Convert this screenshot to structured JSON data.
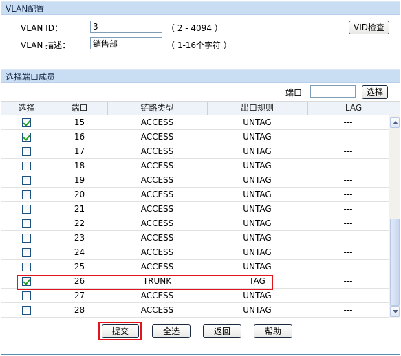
{
  "vlan_config": {
    "section_title": "VLAN配置",
    "vlan_id_label": "VLAN ID：",
    "vlan_id_value": "3",
    "vlan_id_hint": "（ 2 - 4094 ）",
    "vlan_desc_label": "VLAN 描述：",
    "vlan_desc_value": "销售部",
    "vlan_desc_hint": "（ 1-16个字符 ）",
    "vid_check_button": "VID检查"
  },
  "port_members": {
    "section_title": "选择端口成员",
    "port_search_label": "端口",
    "port_search_value": "",
    "select_button": "选择",
    "columns": [
      "选择",
      "端口",
      "链路类型",
      "出口规则",
      "LAG"
    ],
    "rows": [
      {
        "checked": true,
        "port": "15",
        "link_type": "ACCESS",
        "egress": "UNTAG",
        "lag": "---"
      },
      {
        "checked": true,
        "port": "16",
        "link_type": "ACCESS",
        "egress": "UNTAG",
        "lag": "---"
      },
      {
        "checked": false,
        "port": "17",
        "link_type": "ACCESS",
        "egress": "UNTAG",
        "lag": "---"
      },
      {
        "checked": false,
        "port": "18",
        "link_type": "ACCESS",
        "egress": "UNTAG",
        "lag": "---"
      },
      {
        "checked": false,
        "port": "19",
        "link_type": "ACCESS",
        "egress": "UNTAG",
        "lag": "---"
      },
      {
        "checked": false,
        "port": "20",
        "link_type": "ACCESS",
        "egress": "UNTAG",
        "lag": "---"
      },
      {
        "checked": false,
        "port": "21",
        "link_type": "ACCESS",
        "egress": "UNTAG",
        "lag": "---"
      },
      {
        "checked": false,
        "port": "22",
        "link_type": "ACCESS",
        "egress": "UNTAG",
        "lag": "---"
      },
      {
        "checked": false,
        "port": "23",
        "link_type": "ACCESS",
        "egress": "UNTAG",
        "lag": "---"
      },
      {
        "checked": false,
        "port": "24",
        "link_type": "ACCESS",
        "egress": "UNTAG",
        "lag": "---"
      },
      {
        "checked": false,
        "port": "25",
        "link_type": "ACCESS",
        "egress": "UNTAG",
        "lag": "---"
      },
      {
        "checked": true,
        "port": "26",
        "link_type": "TRUNK",
        "egress": "TAG",
        "lag": "---"
      },
      {
        "checked": false,
        "port": "27",
        "link_type": "ACCESS",
        "egress": "UNTAG",
        "lag": "---"
      },
      {
        "checked": false,
        "port": "28",
        "link_type": "ACCESS",
        "egress": "UNTAG",
        "lag": "---"
      }
    ]
  },
  "actions": {
    "submit": "提交",
    "select_all": "全选",
    "back": "返回",
    "help": "帮助"
  },
  "colors": {
    "header_bg": "#c9ddf3",
    "highlight_red": "#e0151d",
    "check_green": "#21a121"
  }
}
